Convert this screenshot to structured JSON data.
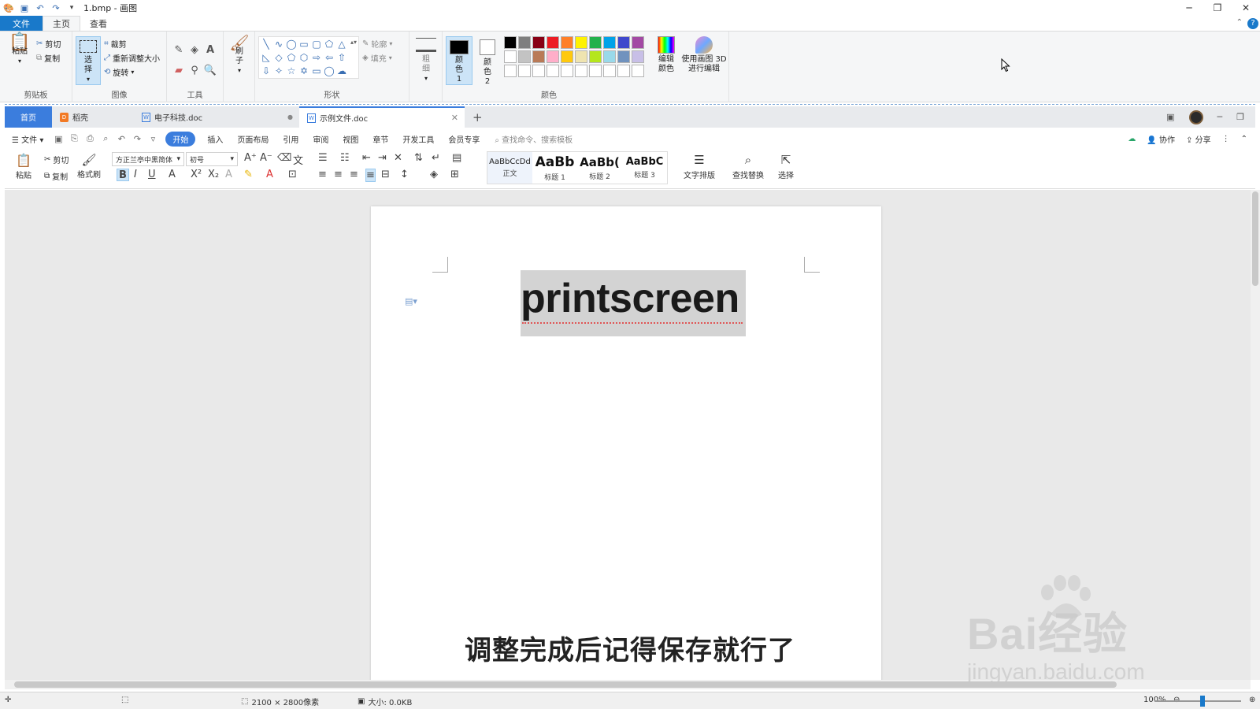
{
  "paint": {
    "window_title": "1.bmp - 画图",
    "tabs": [
      "文件",
      "主页",
      "查看"
    ],
    "clipboard": {
      "paste": "粘贴",
      "cut": "剪切",
      "copy": "复制",
      "group": "剪贴板"
    },
    "image": {
      "select": "选择",
      "crop": "裁剪",
      "resize": "重新调整大小",
      "rotate": "旋转",
      "group": "图像"
    },
    "tools": {
      "group": "工具"
    },
    "brushes": {
      "label": "刷子"
    },
    "shapes": {
      "outline": "轮廓",
      "fill": "填充",
      "group": "形状"
    },
    "size": {
      "label": "粗细"
    },
    "colors": {
      "color1": "颜色 1",
      "color2": "颜色 2",
      "edit": "编辑颜色",
      "paint3d": "使用画图 3D 进行编辑",
      "group": "颜色",
      "palette_row1": [
        "#000000",
        "#7f7f7f",
        "#880015",
        "#ed1c24",
        "#ff7f27",
        "#fff200",
        "#22b14c",
        "#00a2e8",
        "#3f48cc",
        "#a349a4"
      ],
      "palette_row2": [
        "#ffffff",
        "#c3c3c3",
        "#b97a57",
        "#ffaec9",
        "#ffc90e",
        "#efe4b0",
        "#b5e61d",
        "#99d9ea",
        "#7092be",
        "#c8bfe7"
      ]
    },
    "status": {
      "dimensions": "2100 × 2800像素",
      "size": "大小: 0.0KB",
      "zoom": "100%"
    }
  },
  "wps": {
    "tabs": [
      {
        "label": "首页"
      },
      {
        "label": "稻壳"
      },
      {
        "label": "电子科技.doc"
      },
      {
        "label": "示例文件.doc"
      }
    ],
    "menu": [
      "文件",
      "开始",
      "插入",
      "页面布局",
      "引用",
      "审阅",
      "视图",
      "章节",
      "开发工具",
      "会员专享"
    ],
    "search_placeholder": "查找命令、搜索模板",
    "collab": "协作",
    "share": "分享",
    "toolbar": {
      "paste": "粘贴",
      "cut": "剪切",
      "copy": "复制",
      "format_painter": "格式刷",
      "font": "方正兰亭中黑简体",
      "size": "初号",
      "styles": [
        {
          "sample": "AaBbCcDd",
          "label": "正文"
        },
        {
          "sample": "AaBb",
          "label": "标题 1"
        },
        {
          "sample": "AaBb(",
          "label": "标题 2"
        },
        {
          "sample": "AaBbC",
          "label": "标题 3"
        }
      ],
      "text_layout": "文字排版",
      "find_replace": "查找替换",
      "select": "选择"
    },
    "document_text": "printscreen"
  },
  "subtitle": "调整完成后记得保存就行了",
  "watermark": {
    "brand": "Bai经验",
    "url": "jingyan.baidu.com"
  }
}
